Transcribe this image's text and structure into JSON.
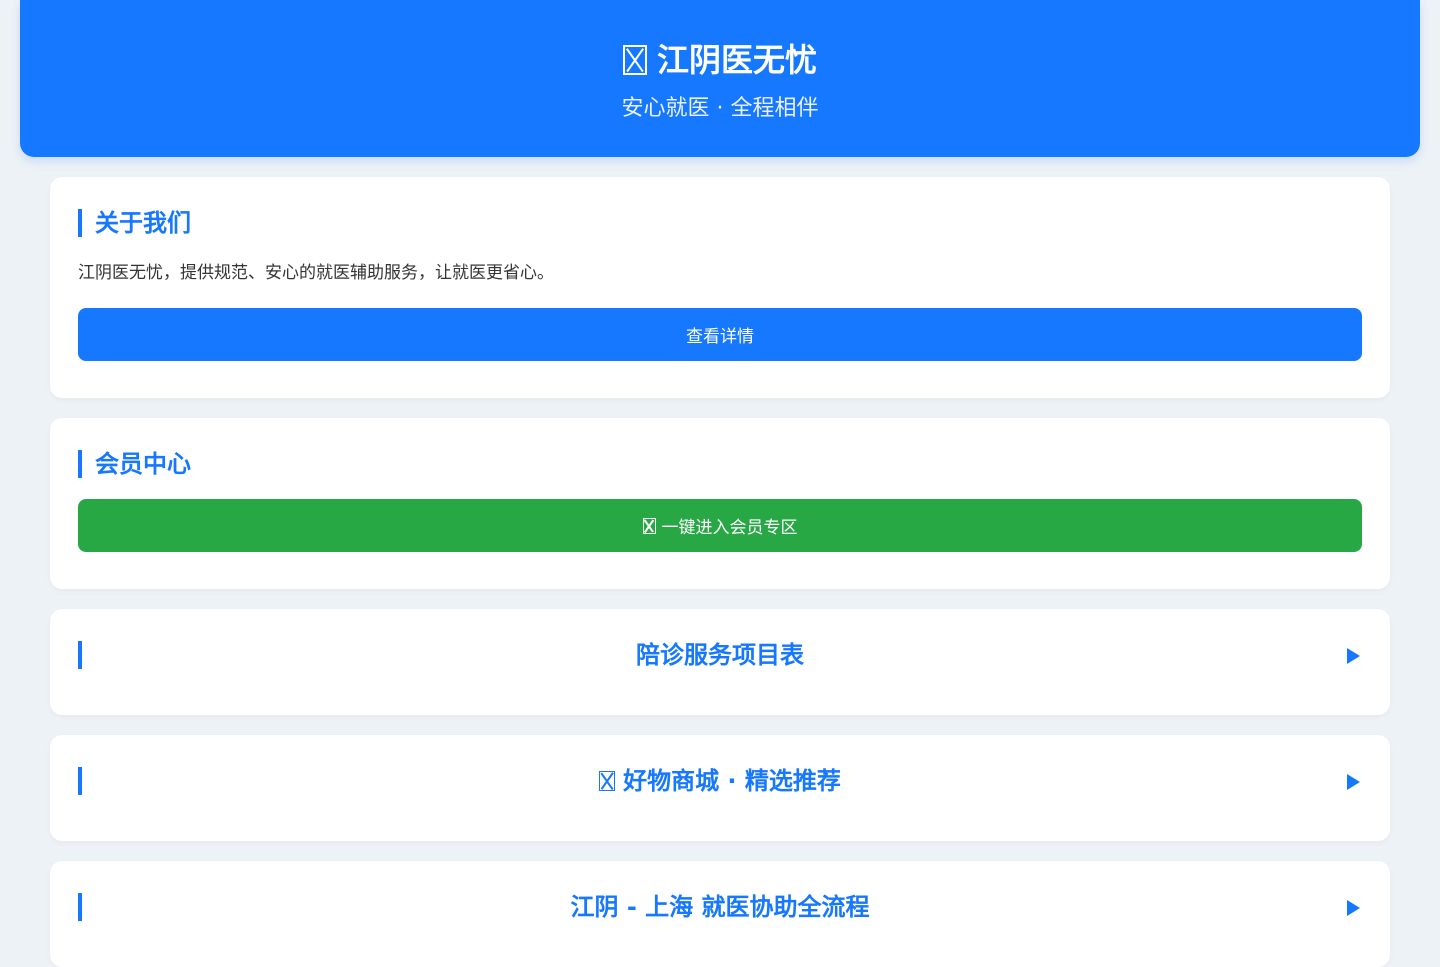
{
  "header": {
    "title_icon": "missing-glyph-icon",
    "title": "江阴医无忧",
    "subtitle": "安心就医 · 全程相伴"
  },
  "about": {
    "title": "关于我们",
    "description": "江阴医无忧，提供规范、安心的就医辅助服务，让就医更省心。",
    "button_label": "查看详情"
  },
  "member": {
    "title": "会员中心",
    "button_icon": "missing-glyph-icon",
    "button_label": "一键进入会员专区"
  },
  "sections": [
    {
      "title": "陪诊服务项目表",
      "icon": null
    },
    {
      "title": "好物商城 · 精选推荐",
      "icon": "missing-glyph-icon"
    },
    {
      "title": "江阴 - 上海 就医协助全流程",
      "icon": null
    }
  ],
  "colors": {
    "primary": "#1677ff",
    "success": "#28a745",
    "background": "#edf2f6"
  }
}
